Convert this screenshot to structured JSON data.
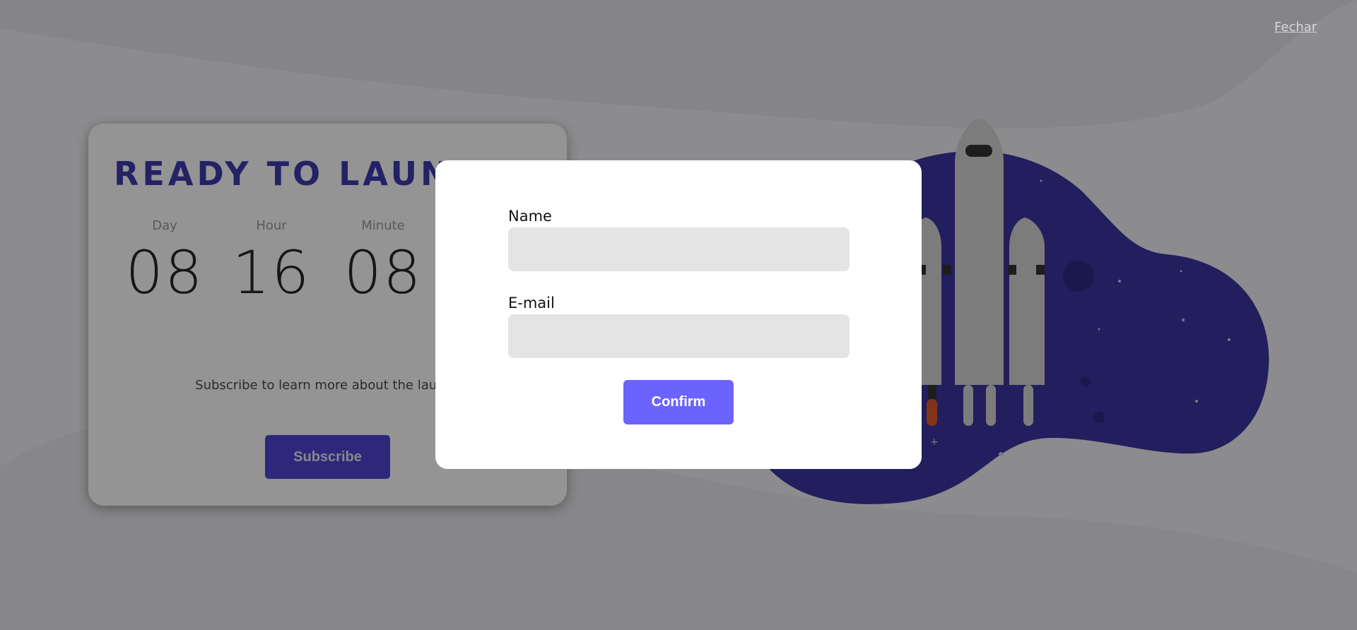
{
  "page": {
    "close_link": "Fechar"
  },
  "card": {
    "title": "READY TO LAUNCH",
    "countdown": [
      {
        "label": "Day",
        "value": "08"
      },
      {
        "label": "Hour",
        "value": "16"
      },
      {
        "label": "Minute",
        "value": "08"
      }
    ],
    "text": "Subscribe to learn more about the launch",
    "subscribe_label": "Subscribe"
  },
  "modal": {
    "name_label": "Name",
    "name_value": "",
    "email_label": "E-mail",
    "email_value": "",
    "confirm_label": "Confirm"
  },
  "colors": {
    "accent": "#6c63ff",
    "title": "#3f3ab0",
    "illustration": "#3d35a0",
    "overlay": "rgba(0,0,0,0.42)"
  },
  "icons": [
    "rocket-illustration",
    "planet-illustration"
  ]
}
